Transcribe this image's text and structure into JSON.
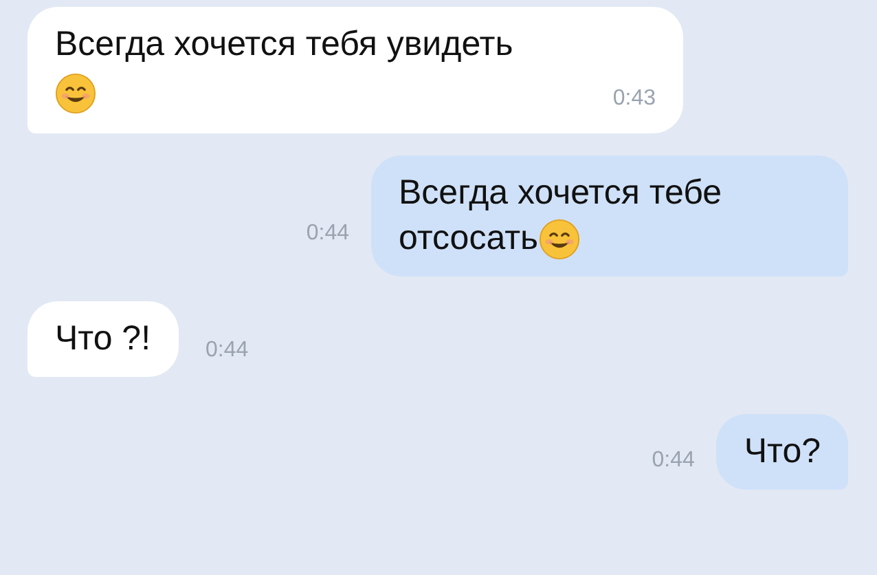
{
  "messages": [
    {
      "kind": "incoming",
      "lines": [
        "Всегда хочется тебя увидеть"
      ],
      "emoji": true,
      "time": "0:43",
      "time_inside": true
    },
    {
      "kind": "outgoing",
      "lines": [
        "Всегда хочется тебе",
        "отсосать"
      ],
      "emoji": true,
      "time": "0:44",
      "time_inside": false
    },
    {
      "kind": "incoming",
      "lines": [
        "Что ?!"
      ],
      "emoji": false,
      "time": "0:44",
      "time_inside": false
    },
    {
      "kind": "outgoing",
      "lines": [
        "Что?"
      ],
      "emoji": false,
      "time": "0:44",
      "time_inside": false
    }
  ]
}
